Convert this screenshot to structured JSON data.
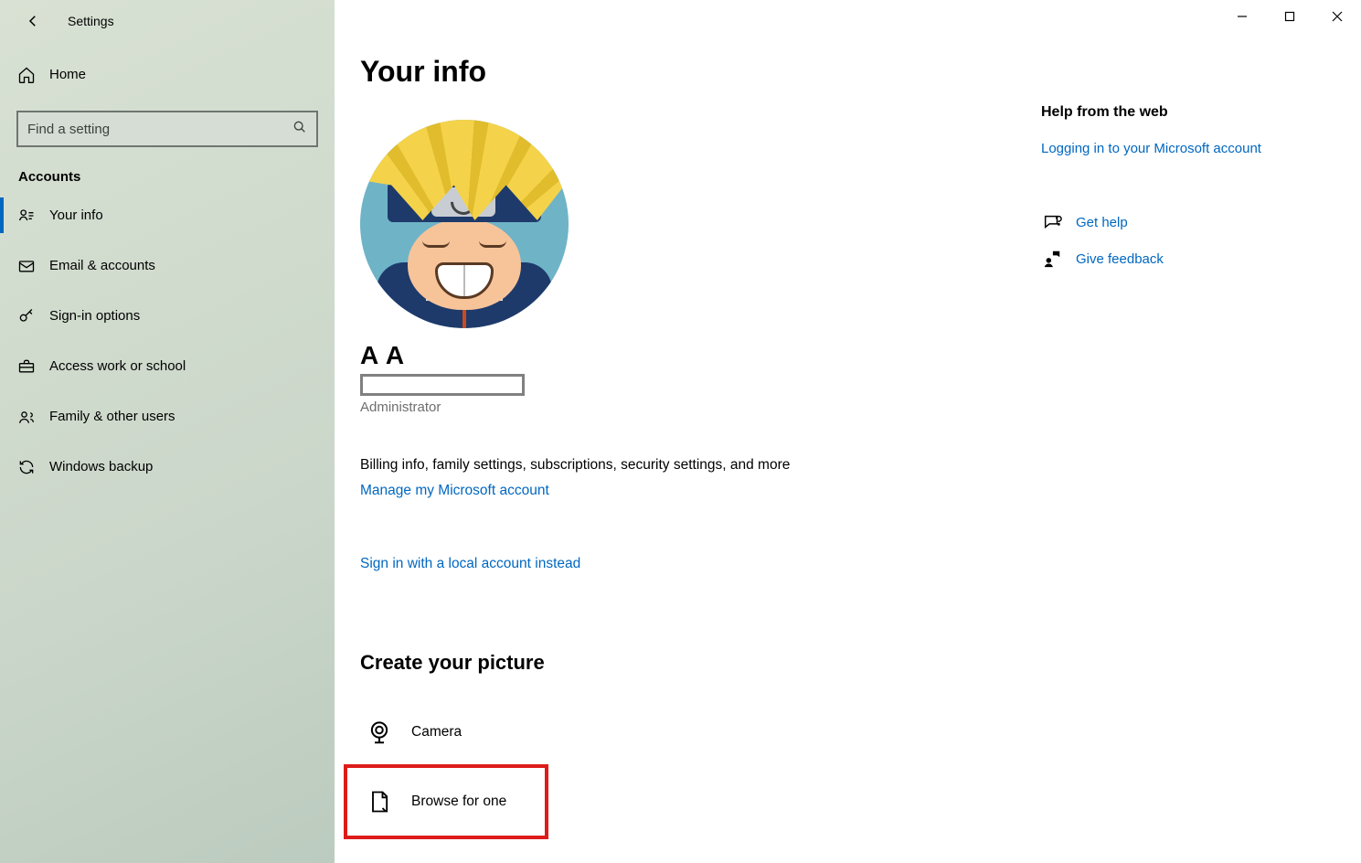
{
  "window": {
    "title": "Settings"
  },
  "nav": {
    "home_label": "Home",
    "search_placeholder": "Find a setting",
    "section_label": "Accounts",
    "items": [
      {
        "label": "Your info"
      },
      {
        "label": "Email & accounts"
      },
      {
        "label": "Sign-in options"
      },
      {
        "label": "Access work or school"
      },
      {
        "label": "Family & other users"
      },
      {
        "label": "Windows backup"
      }
    ]
  },
  "page": {
    "title": "Your info",
    "user_name": "A A",
    "role": "Administrator",
    "billing_desc": "Billing info, family settings, subscriptions, security settings, and more",
    "manage_link": "Manage my Microsoft account",
    "local_link": "Sign in with a local account instead",
    "create_picture_title": "Create your picture",
    "camera_label": "Camera",
    "browse_label": "Browse for one"
  },
  "help": {
    "title": "Help from the web",
    "link1": "Logging in to your Microsoft account",
    "get_help": "Get help",
    "feedback": "Give feedback"
  }
}
